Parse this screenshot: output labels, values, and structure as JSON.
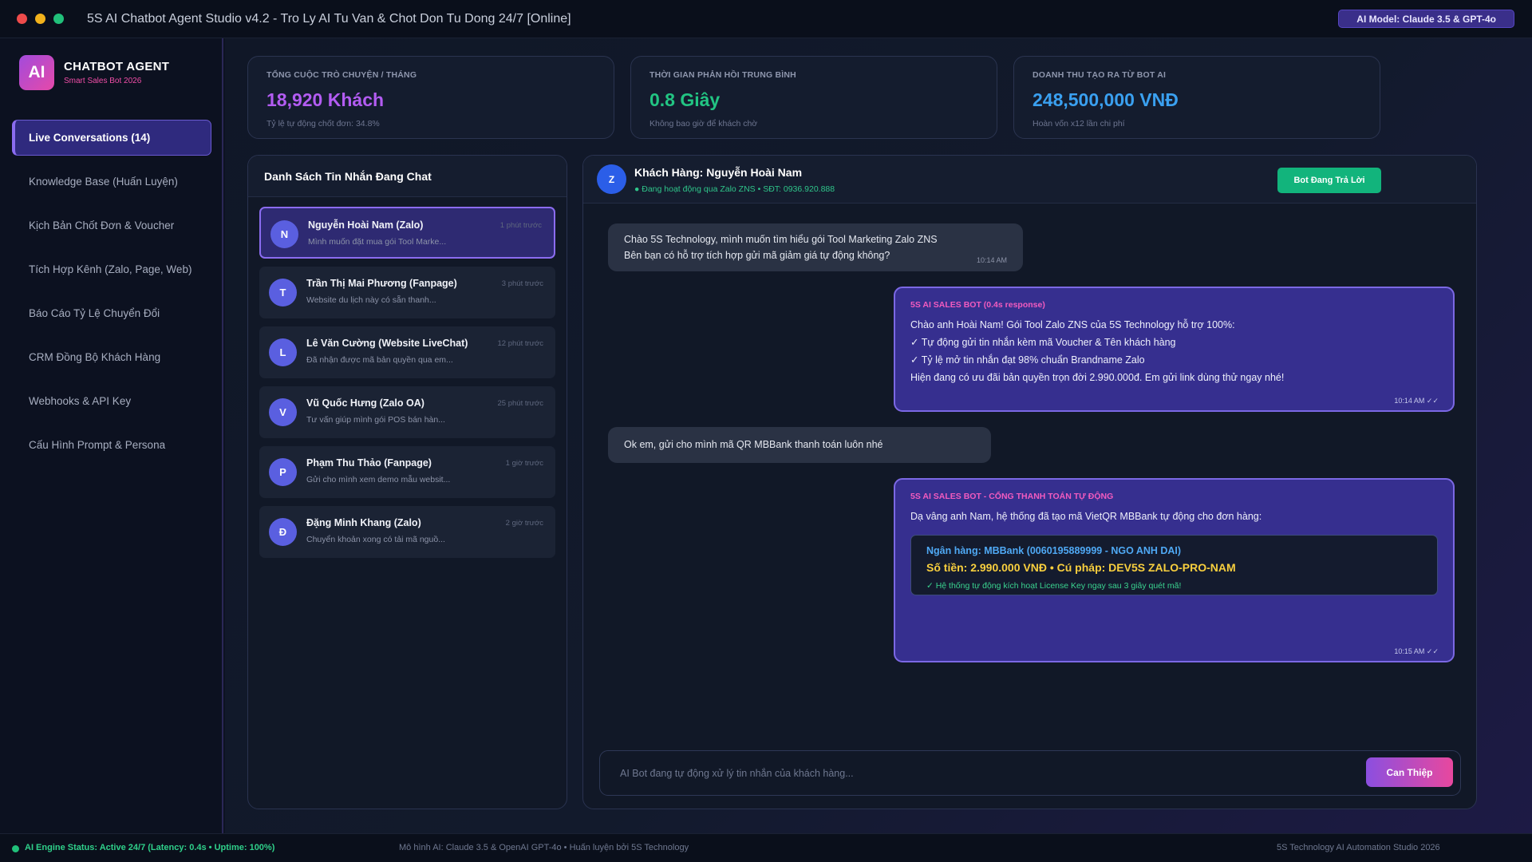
{
  "window": {
    "title": "5S AI Chatbot Agent Studio v4.2 - Tro Ly AI Tu Van & Chot Don Tu Dong 24/7 [Online]",
    "model_badge": "AI Model: Claude 3.5 & GPT-4o"
  },
  "brand": {
    "logo": "AI",
    "name": "CHATBOT AGENT",
    "subtitle": "Smart Sales Bot 2026"
  },
  "sidebar": {
    "items": [
      {
        "label": "Live Conversations (14)",
        "active": true
      },
      {
        "label": "Knowledge Base (Huấn Luyện)"
      },
      {
        "label": "Kịch Bản Chốt Đơn & Voucher"
      },
      {
        "label": "Tích Hợp Kênh (Zalo, Page, Web)"
      },
      {
        "label": "Báo Cáo Tỷ Lệ Chuyển Đổi"
      },
      {
        "label": "CRM Đồng Bộ Khách Hàng"
      },
      {
        "label": "Webhooks & API Key"
      },
      {
        "label": "Cấu Hình Prompt & Persona"
      }
    ]
  },
  "stats": [
    {
      "label": "TỔNG CUỘC TRÒ CHUYỆN / THÁNG",
      "value": "18,920 Khách",
      "note": "Tỷ lệ tự động chốt đơn: 34.8%",
      "color": "#b35cf2"
    },
    {
      "label": "THỜI GIAN PHẢN HỒI TRUNG BÌNH",
      "value": "0.8 Giây",
      "note": "Không bao giờ để khách chờ",
      "color": "#22c583"
    },
    {
      "label": "DOANH THU TẠO RA TỪ BOT AI",
      "value": "248,500,000 VNĐ",
      "note": "Hoàn vốn x12 lần chi phí",
      "color": "#3aa0f0"
    }
  ],
  "conversation_list": {
    "title": "Danh Sách Tin Nhắn Đang Chat",
    "items": [
      {
        "initial": "N",
        "name": "Nguyễn Hoài Nam (Zalo)",
        "time": "1 phút trước",
        "preview": "Mình muốn đặt mua gói Tool Marke...",
        "active": true
      },
      {
        "initial": "T",
        "name": "Trần Thị Mai Phương (Fanpage)",
        "time": "3 phút trước",
        "preview": "Website du lịch này có sẵn thanh..."
      },
      {
        "initial": "L",
        "name": "Lê Văn Cường (Website LiveChat)",
        "time": "12 phút trước",
        "preview": "Đã nhận được mã bản quyền qua em..."
      },
      {
        "initial": "V",
        "name": "Vũ Quốc Hưng (Zalo OA)",
        "time": "25 phút trước",
        "preview": "Tư vấn giúp mình gói POS bán hàn..."
      },
      {
        "initial": "P",
        "name": "Phạm Thu Thảo (Fanpage)",
        "time": "1 giờ trước",
        "preview": "Gửi cho mình xem demo mẫu websit..."
      },
      {
        "initial": "Đ",
        "name": "Đặng Minh Khang (Zalo)",
        "time": "2 giờ trước",
        "preview": "Chuyển khoản xong có tải mã nguồ..."
      }
    ]
  },
  "chat": {
    "avatar": "Z",
    "customer": "Khách Hàng: Nguyễn Hoài Nam",
    "status": "● Đang hoạt động qua Zalo ZNS • SĐT: 0936.920.888",
    "bot_button": "Bot Đang Trả Lời",
    "messages": {
      "m1": {
        "lines": [
          "Chào 5S Technology, mình muốn tìm hiểu gói Tool Marketing Zalo ZNS",
          "Bên bạn có hỗ trợ tích hợp gửi mã giảm giá tự động không?"
        ],
        "time": "10:14 AM"
      },
      "m2": {
        "label": "5S AI SALES BOT (0.4s response)",
        "lines": [
          "Chào anh Hoài Nam! Gói Tool Zalo ZNS của 5S Technology hỗ trợ 100%:",
          "✓ Tự động gửi tin nhắn kèm mã Voucher & Tên khách hàng",
          "✓ Tỷ lệ mở tin nhắn đạt 98% chuẩn Brandname Zalo",
          "Hiện đang có ưu đãi bản quyền trọn đời 2.990.000đ. Em gửi link dùng thử ngay nhé!"
        ],
        "time": "10:14 AM ✓✓"
      },
      "m3": {
        "text": "Ok em, gửi cho mình mã QR MBBank thanh toán luôn nhé"
      },
      "m4": {
        "label": "5S AI SALES BOT - CỔNG THANH TOÁN TỰ ĐỘNG",
        "text": "Dạ vâng anh Nam, hệ thống đã tạo mã VietQR MBBank tự động cho đơn hàng:",
        "bank": "Ngân hàng: MBBank (0060195889999 - NGO ANH DAI)",
        "amount": "Số tiền: 2.990.000 VNĐ • Cú pháp: DEV5S ZALO-PRO-NAM",
        "note": "✓ Hệ thống tự động kích hoạt License Key ngay sau 3 giây quét mã!",
        "time": "10:15 AM ✓✓"
      }
    },
    "input_placeholder": "AI Bot đang tự động xử lý tin nhắn của khách hàng...",
    "intervene_button": "Can Thiệp"
  },
  "footer": {
    "status": "AI Engine Status: Active 24/7 (Latency: 0.4s • Uptime: 100%)",
    "middle": "Mô hình AI: Claude 3.5 & OpenAI GPT-4o • Huấn luyện bởi 5S Technology",
    "right": "5S Technology AI Automation Studio 2026"
  }
}
